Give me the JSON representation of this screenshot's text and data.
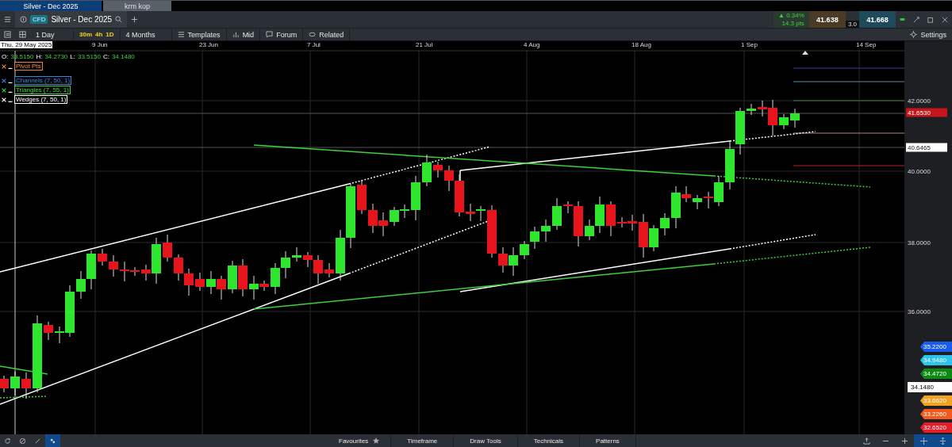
{
  "window_tabs": [
    {
      "label": "Silver - Dec 2025",
      "selected": true
    },
    {
      "label": "krm kop",
      "selected": false
    }
  ],
  "header": {
    "badge": "CFD",
    "instrument": "Silver - Dec 2025",
    "change": "▲ 0.34%",
    "change_points": "14.3 pts",
    "sell": "41.638",
    "buy": "41.668",
    "spread": "3.0"
  },
  "toolbar": {
    "period": "1 Day",
    "intervals": [
      "30m",
      "4h",
      "1D"
    ],
    "range": "4 Months",
    "buttons": [
      "Templates",
      "Mid",
      "Forum",
      "Related"
    ],
    "settings": "Settings"
  },
  "chart": {
    "crosshair_date": "Thu, 29 May 2025",
    "ohlc": [
      {
        "label": "O:",
        "value": "33.5150"
      },
      {
        "label": "H:",
        "value": "34.2730"
      },
      {
        "label": "L:",
        "value": "33.5150"
      },
      {
        "label": "C:",
        "value": "34.1480"
      }
    ],
    "indicators": [
      {
        "name": "Pivot Pts",
        "color": "#e8833a"
      },
      {
        "name": "Channels (7, 50, 1)",
        "color": "#3d7fd9"
      },
      {
        "name": "Triangles (7, 55, 1)",
        "color": "#3fcf3f"
      },
      {
        "name": "Wedges (7, 50, 1)",
        "color": "#ffffff"
      }
    ],
    "dates": [
      "9 Jun",
      "23 Jun",
      "7 Jul",
      "21 Jul",
      "4 Aug",
      "18 Aug",
      "1 Sep",
      "14 Sep"
    ],
    "axis_labels": [
      {
        "kind": "tick",
        "text": "42.0000"
      },
      {
        "kind": "last",
        "text": "41.6530"
      },
      {
        "kind": "marker",
        "text": "40.6465"
      },
      {
        "kind": "tick",
        "text": "40.0000"
      },
      {
        "kind": "tick",
        "text": "38.0000"
      },
      {
        "kind": "tick",
        "text": "36.0000"
      }
    ],
    "price_tags": [
      {
        "text": "35.2200",
        "color": "#1a5cf0"
      },
      {
        "text": "34.9480",
        "color": "#2cc4ec"
      },
      {
        "text": "34.4720",
        "color": "#0c8a12"
      },
      {
        "text": "34.1480",
        "color": "#ffffff"
      },
      {
        "text": "33.6620",
        "color": "#f3a21f"
      },
      {
        "text": "33.2260",
        "color": "#f05a1c"
      },
      {
        "text": "32.6520",
        "color": "#e51d28"
      }
    ]
  },
  "bottom_bar": {
    "left_tools": [
      {
        "selected": false
      },
      {
        "selected": false
      },
      {
        "selected": false
      },
      {
        "selected": true
      }
    ],
    "tabs": [
      "Favourites",
      "Timeframe",
      "Draw Tools",
      "Technicals",
      "Patterns"
    ],
    "right_tools": [
      {
        "selected": false
      },
      {
        "selected": false
      },
      {
        "selected": false
      },
      {
        "selected": true
      },
      {
        "selected": true
      }
    ]
  }
}
